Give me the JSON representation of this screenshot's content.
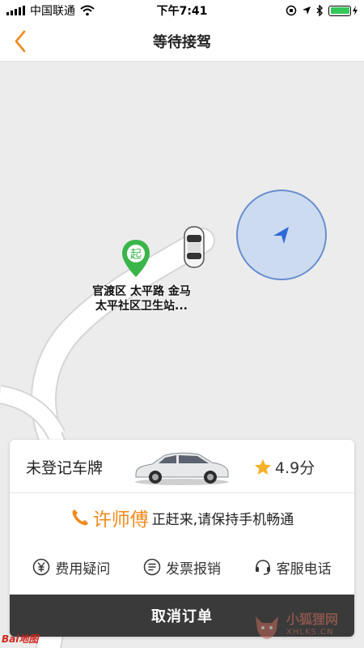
{
  "status_bar": {
    "carrier": "中国联通",
    "time": "下午7:41",
    "battery_color": "#34c759"
  },
  "nav": {
    "title": "等待接驾",
    "back_icon": "chevron-left-icon",
    "accent_color": "#f08a1c"
  },
  "map": {
    "start_marker_glyph": "起",
    "start_label_line1": "官渡区 太平路 金马",
    "start_label_line2": "太平社区卫生站...",
    "start_marker_color": "#3ab54a",
    "location_arrow_color": "#2f6ad8"
  },
  "trip_card": {
    "plate": "未登记车牌",
    "rating": "4.9分",
    "driver_name": "许师傅",
    "driver_message": "正赶来,请保持手机畅通",
    "actions": [
      {
        "label": "费用疑问",
        "icon": "yuan-icon"
      },
      {
        "label": "发票报销",
        "icon": "invoice-icon"
      },
      {
        "label": "客服电话",
        "icon": "headset-icon"
      }
    ],
    "cancel_label": "取消订单"
  },
  "watermarks": {
    "baidu": "Bai地图",
    "site_cn": "小狐狸网",
    "site_en": "XHLKS.CN"
  }
}
